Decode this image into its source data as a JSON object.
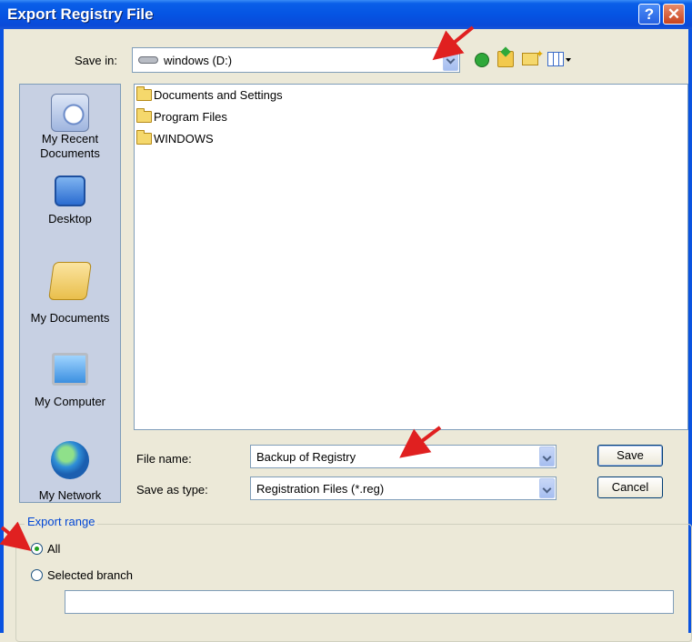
{
  "window": {
    "title": "Export Registry File"
  },
  "save_in": {
    "label": "Save in:",
    "value": "windows (D:)"
  },
  "toolbar_icons": [
    "back-icon",
    "up-folder-icon",
    "new-folder-icon",
    "views-menu-icon"
  ],
  "places": [
    {
      "label": "My Recent Documents",
      "icon": "recent-documents-icon"
    },
    {
      "label": "Desktop",
      "icon": "desktop-icon"
    },
    {
      "label": "My Documents",
      "icon": "my-documents-icon"
    },
    {
      "label": "My Computer",
      "icon": "my-computer-icon"
    },
    {
      "label": "My Network",
      "icon": "my-network-icon"
    }
  ],
  "files": [
    {
      "name": "Documents and Settings",
      "icon": "folder-icon"
    },
    {
      "name": "Program Files",
      "icon": "folder-icon"
    },
    {
      "name": "WINDOWS",
      "icon": "folder-icon"
    }
  ],
  "file_name": {
    "label": "File name:",
    "value": "Backup of Registry"
  },
  "save_as_type": {
    "label": "Save as type:",
    "value": "Registration Files (*.reg)"
  },
  "buttons": {
    "save": "Save",
    "cancel": "Cancel"
  },
  "export_range": {
    "label": "Export range",
    "all": "All",
    "selected_branch": "Selected branch",
    "selected": "All",
    "branch_value": ""
  },
  "colors": {
    "title_bar": "#0554e3",
    "annotation_arrow": "#e02020",
    "group_label": "#0046d5"
  }
}
